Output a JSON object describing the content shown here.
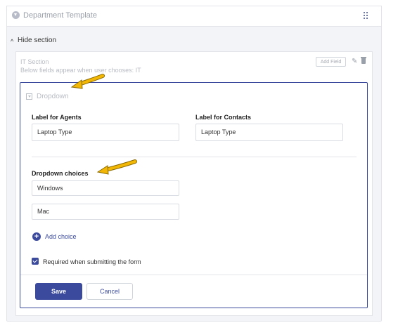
{
  "template": {
    "title": "Department Template",
    "toggle_label": "Hide section"
  },
  "section": {
    "title": "IT Section",
    "subtitle": "Below fields appear when user chooses: IT",
    "add_field_label": "Add Field"
  },
  "field": {
    "type_label": "Dropdown",
    "agents_label": "Label for Agents",
    "agents_value": "Laptop Type",
    "contacts_label": "Label for Contacts",
    "contacts_value": "Laptop Type",
    "choices_label": "Dropdown choices",
    "choices": [
      "Windows",
      "Mac"
    ],
    "add_choice_label": "Add choice",
    "required_label": "Required when submitting the form",
    "required_checked": true
  },
  "actions": {
    "save_label": "Save",
    "cancel_label": "Cancel"
  },
  "colors": {
    "accent": "#3b4a9c",
    "annotation_arrow": "#f2b705"
  }
}
